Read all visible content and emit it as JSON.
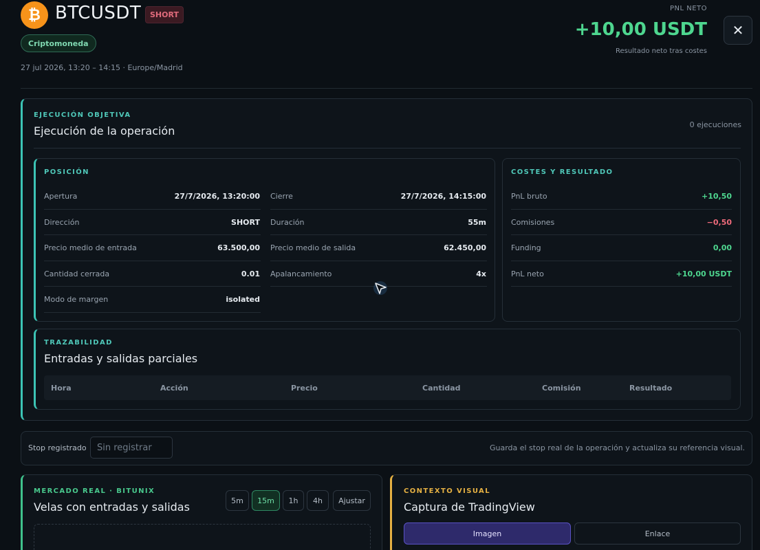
{
  "header": {
    "symbol": "BTCUSDT",
    "side": "SHORT",
    "category": "Criptomoneda",
    "datetime": "27 jul 2026, 13:20 – 14:15 · Europe/Madrid",
    "pnl_label": "PNL NETO",
    "pnl_value": "+10,00 USDT",
    "pnl_sub": "Resultado neto tras costes",
    "close_label": "✕",
    "logo_glyph": "₿"
  },
  "execution": {
    "kicker": "EJECUCIÓN OBJETIVA",
    "title": "Ejecución de la operación",
    "count": "0 ejecuciones"
  },
  "position": {
    "kicker": "POSICIÓN",
    "left": [
      {
        "label": "Apertura",
        "value": "27/7/2026, 13:20:00"
      },
      {
        "label": "Dirección",
        "value": "SHORT"
      },
      {
        "label": "Precio medio de entrada",
        "value": "63.500,00"
      },
      {
        "label": "Cantidad cerrada",
        "value": "0.01"
      },
      {
        "label": "Modo de margen",
        "value": "isolated"
      }
    ],
    "right": [
      {
        "label": "Cierre",
        "value": "27/7/2026, 14:15:00"
      },
      {
        "label": "Duración",
        "value": "55m"
      },
      {
        "label": "Precio medio de salida",
        "value": "62.450,00"
      },
      {
        "label": "Apalancamiento",
        "value": "4x"
      }
    ]
  },
  "costs": {
    "kicker": "COSTES Y RESULTADO",
    "rows": [
      {
        "label": "PnL bruto",
        "value": "+10,50"
      },
      {
        "label": "Comisiones",
        "value": "−0,50"
      },
      {
        "label": "Funding",
        "value": "0,00"
      },
      {
        "label": "PnL neto",
        "value": "+10,00 USDT"
      }
    ]
  },
  "trace": {
    "kicker": "TRAZABILIDAD",
    "title": "Entradas y salidas parciales",
    "columns": [
      "Hora",
      "Acción",
      "Precio",
      "Cantidad",
      "Comisión",
      "Resultado"
    ]
  },
  "stop": {
    "label": "Stop registrado",
    "placeholder": "Sin registrar",
    "value": "",
    "hint": "Guarda el stop real de la operación y actualiza su referencia visual."
  },
  "market": {
    "kicker": "MERCADO REAL · BITUNIX",
    "title": "Velas con entradas y salidas",
    "timeframes": [
      "5m",
      "15m",
      "1h",
      "4h"
    ],
    "active_timeframe": "15m",
    "fit_label": "Ajustar"
  },
  "visual": {
    "kicker": "CONTEXTO VISUAL",
    "title": "Captura de TradingView",
    "tabs": [
      "Imagen",
      "Enlace"
    ],
    "active_tab": "Imagen"
  },
  "colors": {
    "background": "#0b1015",
    "positive": "#4ed68f",
    "negative": "#ef6b7b",
    "accent_teal": "#3cc4b5",
    "accent_amber": "#e6b143",
    "brand_btc": "#f7931a"
  }
}
